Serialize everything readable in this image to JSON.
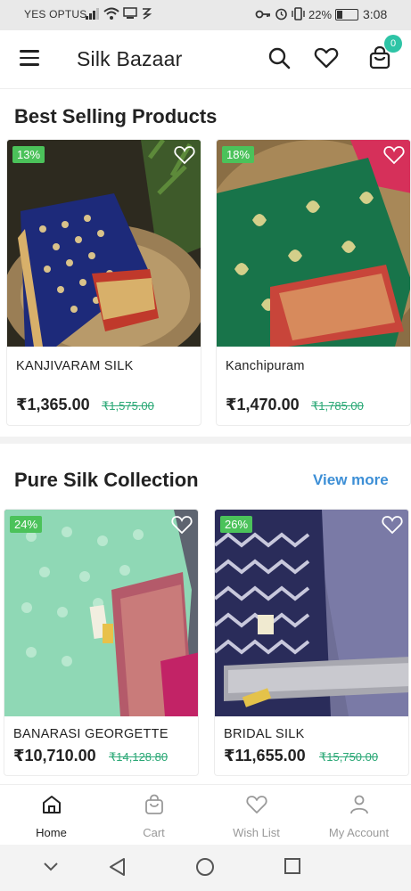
{
  "status_bar": {
    "carrier": "YES OPTUS",
    "battery": "22%",
    "time": "3:08"
  },
  "app_bar": {
    "title": "Silk Bazaar",
    "cart_count": "0"
  },
  "best_selling": {
    "title": "Best Selling Products",
    "products": [
      {
        "discount": "13%",
        "name": "KANJIVARAM SILK",
        "price": "₹1,365.00",
        "old_price": "₹1,575.00"
      },
      {
        "discount": "18%",
        "name": "Kanchipuram",
        "price": "₹1,470.00",
        "old_price": "₹1,785.00"
      }
    ]
  },
  "pure_silk": {
    "title": "Pure Silk Collection",
    "view_more": "View more",
    "products": [
      {
        "discount": "24%",
        "name": "BANARASI GEORGETTE",
        "price": "₹10,710.00",
        "old_price": "₹14,128.80"
      },
      {
        "discount": "26%",
        "name": "BRIDAL SILK",
        "price": "₹11,655.00",
        "old_price": "₹15,750.00"
      }
    ]
  },
  "bottom_nav": {
    "items": [
      {
        "label": "Home",
        "icon": "home-icon",
        "active": true
      },
      {
        "label": "Cart",
        "icon": "bag-icon",
        "active": false
      },
      {
        "label": "Wish List",
        "icon": "heart-icon",
        "active": false
      },
      {
        "label": "My Account",
        "icon": "user-icon",
        "active": false
      }
    ]
  },
  "colors": {
    "accent": "#2ec4a6",
    "discount_badge": "#4bc25a",
    "old_price": "#2aa876",
    "link": "#3d8fd6"
  }
}
